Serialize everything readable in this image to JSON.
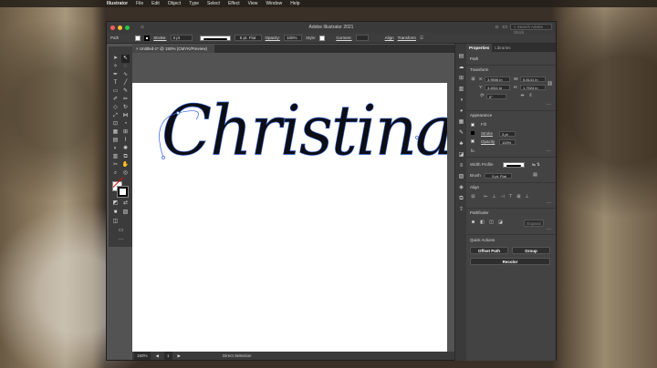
{
  "menubar": {
    "apple": "",
    "items": [
      "Illustrator",
      "File",
      "Edit",
      "Object",
      "Type",
      "Select",
      "Effect",
      "View",
      "Window",
      "Help"
    ]
  },
  "window": {
    "title": "Adobe Illustrator 2021",
    "search_placeholder": "Search Adobe Stock"
  },
  "control_bar": {
    "object_label": "Path",
    "stroke_label": "Stroke:",
    "stroke_weight": "3 pt",
    "brush_label": "5 pt. Flat",
    "opacity_label": "Opacity:",
    "opacity_value": "100%",
    "style_label": "Style:",
    "corners_label": "Corners:",
    "align_link": "Align",
    "transform_link": "Transform"
  },
  "document": {
    "tab_title": "Untitled-1* @ 150% (CMYK/Preview)",
    "artwork_text": "Christina"
  },
  "status": {
    "zoom": "150%",
    "artboard_nav": "1",
    "tool_name": "Direct Selection"
  },
  "properties": {
    "tabs": [
      "Properties",
      "Libraries"
    ],
    "selection_type": "Path",
    "transform": {
      "title": "Transform",
      "x_label": "X:",
      "x_value": "3.9506 in",
      "y_label": "Y:",
      "y_value": "3.4511 in",
      "w_label": "W:",
      "w_value": "5.8141 in",
      "h_label": "H:",
      "h_value": "1.7924 in",
      "angle_value": "0°"
    },
    "appearance": {
      "title": "Appearance",
      "fill_label": "Fill",
      "stroke_label": "Stroke",
      "stroke_value": "3 pt",
      "opacity_label": "Opacity",
      "opacity_value": "100%",
      "fx_label": "fx."
    },
    "width_profile_label": "Width Profile",
    "brush_label": "Brush",
    "brush_value": "5 pt. Flat",
    "align_title": "Align",
    "pathfinder": {
      "title": "Pathfinder",
      "expand_button": "Expand"
    },
    "quick_actions": {
      "title": "Quick Actions",
      "offset_path": "Offset Path",
      "group": "Group",
      "recolor": "Recolor"
    }
  },
  "colors": {
    "ui_dark": "#3a3a3a",
    "panel": "#434343",
    "artboard": "#ffffff",
    "ink": "#0d0d14",
    "selection_blue": "#2f5fd6"
  }
}
